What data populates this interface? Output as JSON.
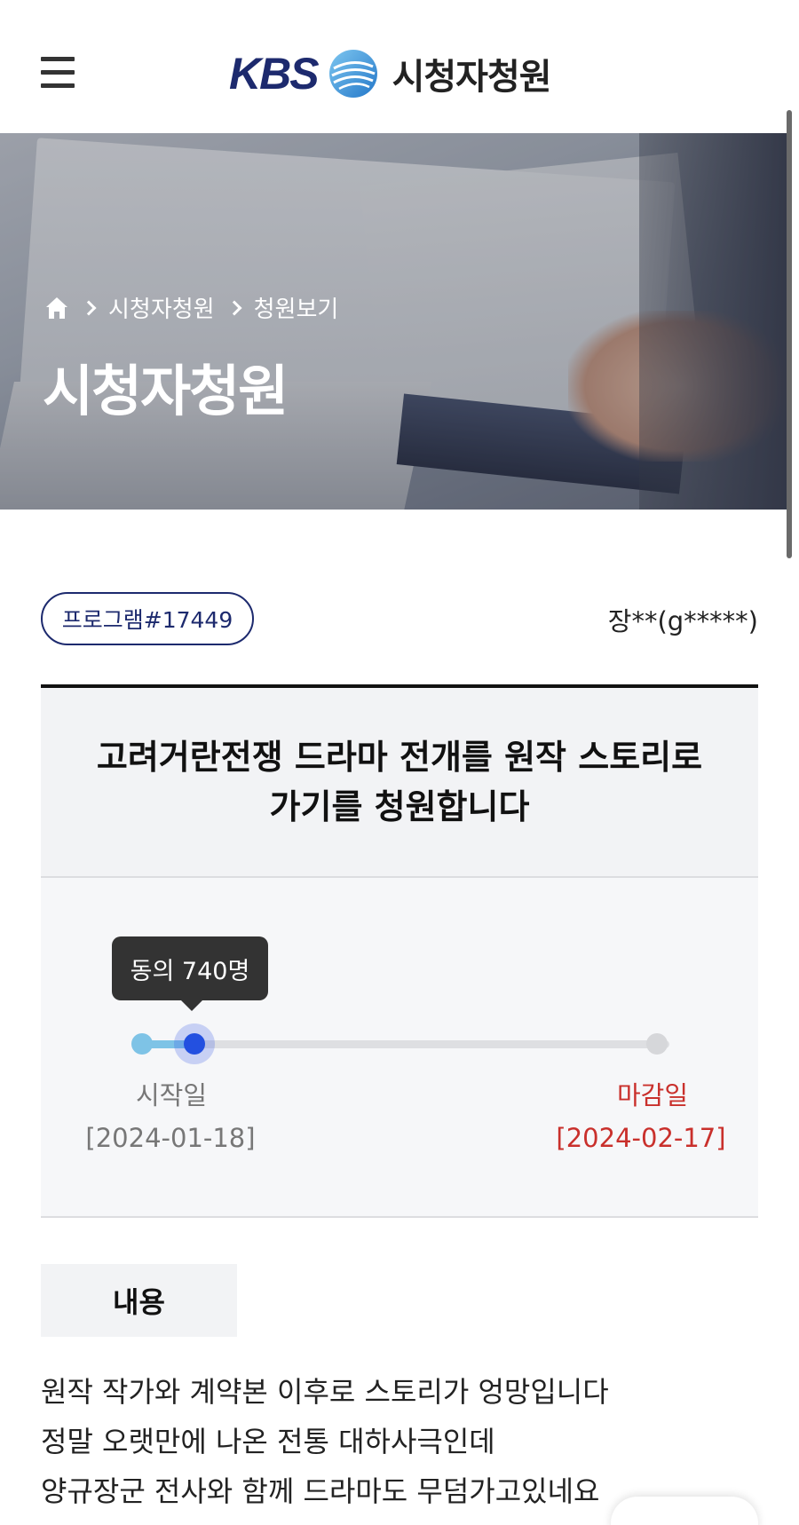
{
  "header": {
    "logo_text": "KBS",
    "title": "시청자청원"
  },
  "hero": {
    "breadcrumb": [
      "시청자청원",
      "청원보기"
    ],
    "title": "시청자청원"
  },
  "petition": {
    "tag": "프로그램#17449",
    "author": "장**(g*****)",
    "title": "고려거란전쟁 드라마 전개를 원작 스토리로 가기를 청원합니다",
    "agree_label": "동의 740명",
    "progress_fraction": 0.1,
    "start_label": "시작일",
    "start_date": "[2024-01-18]",
    "end_label": "마감일",
    "end_date": "[2024-02-17]",
    "content_label": "내용",
    "content_lines": [
      "원작 작가와 계약본 이후로 스토리가 엉망입니다",
      "정말 오랫만에 나온 전통 대하사극인데",
      "양규장군 전사와 함께 드라마도 무덤가고있네요"
    ]
  },
  "colors": {
    "brand_navy": "#1d2a6e",
    "progress_fill": "#7ec3e6",
    "knob": "#2350e0",
    "deadline_red": "#c9302c"
  },
  "icons": [
    "hamburger-menu-icon",
    "kbs-globe-icon",
    "home-icon",
    "chevron-right-icon"
  ]
}
